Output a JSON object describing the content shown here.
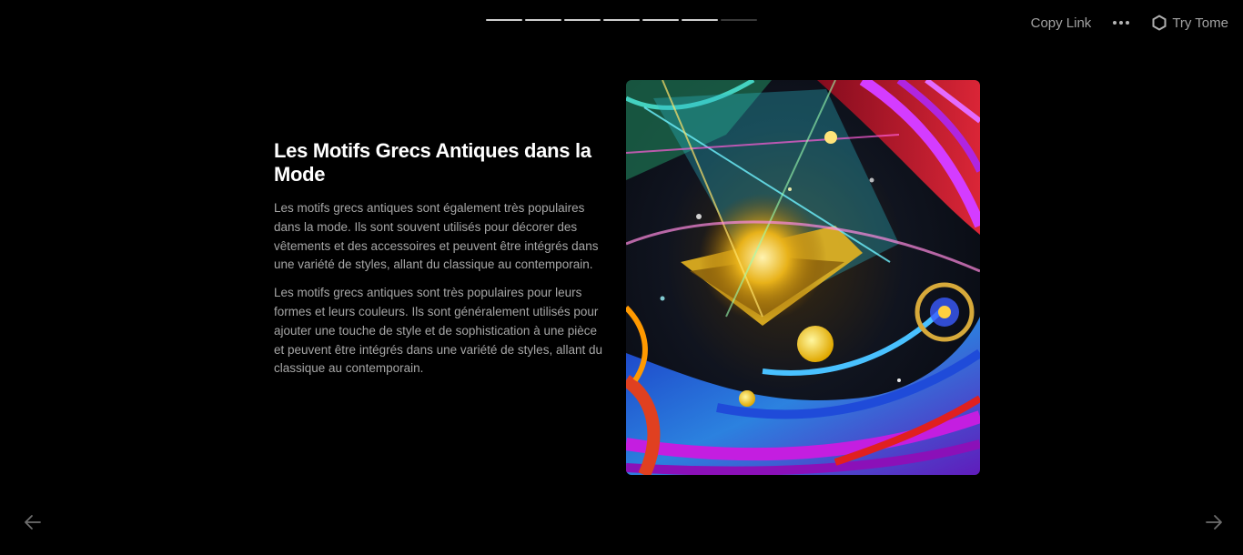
{
  "progress": {
    "total_slides": 7,
    "current_slide": 6
  },
  "topbar": {
    "copy_link_label": "Copy Link",
    "try_tome_label": "Try Tome"
  },
  "slide": {
    "title": "Les Motifs Grecs Antiques dans la Mode",
    "paragraphs": [
      "Les motifs grecs antiques sont également très populaires dans la mode. Ils sont souvent utilisés pour décorer des vêtements et des accessoires et peuvent être intégrés dans une variété de styles, allant du classique au contemporain.",
      "Les motifs grecs antiques sont très populaires pour leurs formes et leurs couleurs. Ils sont généralement utilisés pour ajouter une touche de style et de sophistication à une pièce et peuvent être intégrés dans une variété de styles, allant du classique au contemporain."
    ]
  },
  "colors": {
    "background": "#000000",
    "title": "#ffffff",
    "body_text": "#a6a6a6",
    "progress_active": "#cfcfcf",
    "progress_inactive": "#3a3a3a"
  },
  "icons": {
    "more": "more-horizontal-icon",
    "tome_logo": "tome-logo-icon",
    "prev": "arrow-left-icon",
    "next": "arrow-right-icon"
  }
}
